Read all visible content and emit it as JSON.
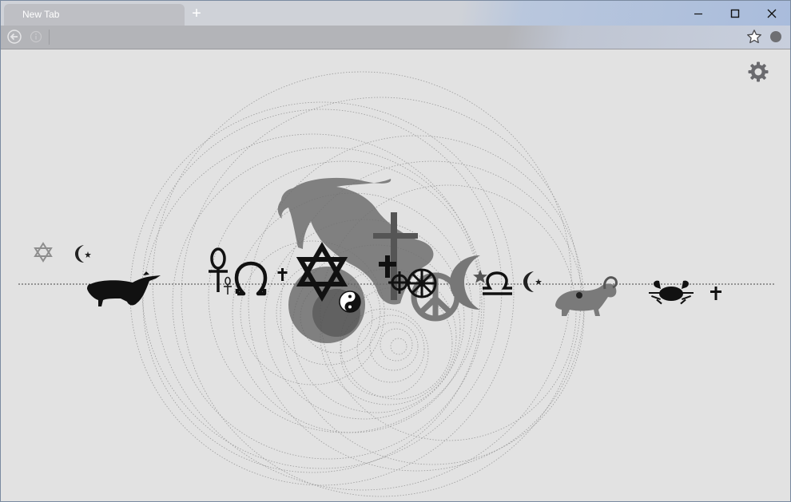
{
  "browser": {
    "tab_title": "New Tab",
    "new_tab_symbol": "+"
  },
  "window_controls": [
    {
      "name": "minimize-icon"
    },
    {
      "name": "maximize-icon"
    },
    {
      "name": "close-icon"
    }
  ],
  "toolbar": {
    "icons": [
      "back-arrow-icon",
      "info-icon",
      "bookmark-star-icon",
      "extension-icon"
    ]
  },
  "artwork": {
    "symbols": [
      "star-of-david",
      "star-and-crescent",
      "bull",
      "ankh",
      "omega",
      "cross",
      "star-of-david",
      "yin-yang",
      "capricorn-goat",
      "cross",
      "dharma-wheel",
      "peace-symbol",
      "crescent-and-star",
      "libra",
      "star-and-crescent",
      "ram",
      "crab",
      "cross"
    ]
  },
  "colors": {
    "page_background": "#e2e2e2",
    "symbols_dark": "#111111",
    "symbols_mid": "#6f6f6f",
    "symbols_light": "#9a9a9a"
  }
}
